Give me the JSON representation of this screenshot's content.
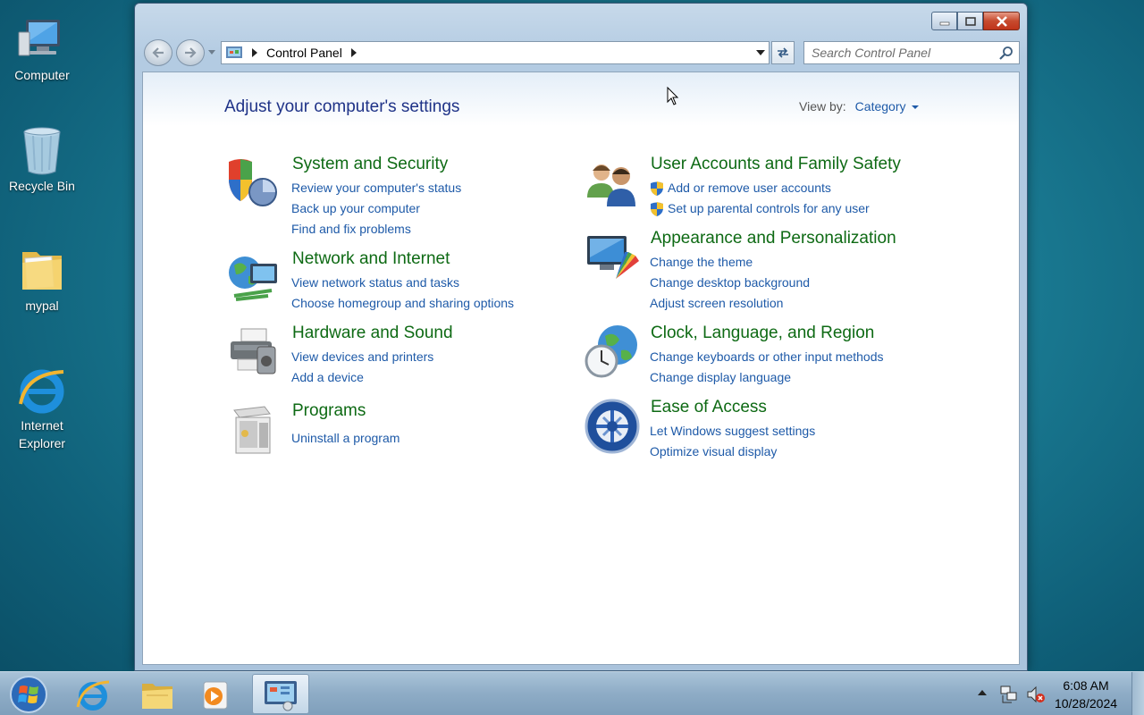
{
  "desktop": {
    "icons": [
      {
        "label": "Computer",
        "icon": "computer-icon"
      },
      {
        "label": "Recycle Bin",
        "icon": "recycle-bin-icon"
      },
      {
        "label": "mypal",
        "icon": "folder-icon"
      },
      {
        "label_line1": "Internet",
        "label_line2": "Explorer",
        "icon": "internet-explorer-icon"
      }
    ]
  },
  "window": {
    "address": {
      "segment": "Control Panel"
    },
    "search": {
      "placeholder": "Search Control Panel"
    },
    "heading": "Adjust your computer's settings",
    "view_by": {
      "label": "View by:",
      "value": "Category"
    },
    "categories": [
      {
        "title": "System and Security",
        "icon": "system-security-icon",
        "links": [
          "Review your computer's status",
          "Back up your computer",
          "Find and fix problems"
        ]
      },
      {
        "title": "Network and Internet",
        "icon": "network-internet-icon",
        "links": [
          "View network status and tasks",
          "Choose homegroup and sharing options"
        ]
      },
      {
        "title": "Hardware and Sound",
        "icon": "hardware-sound-icon",
        "links": [
          "View devices and printers",
          "Add a device"
        ]
      },
      {
        "title": "Programs",
        "icon": "programs-icon",
        "links": [
          "Uninstall a program"
        ]
      },
      {
        "title": "User Accounts and Family Safety",
        "icon": "user-accounts-icon",
        "links": [
          "Add or remove user accounts",
          "Set up parental controls for any user"
        ]
      },
      {
        "title": "Appearance and Personalization",
        "icon": "appearance-icon",
        "links": [
          "Change the theme",
          "Change desktop background",
          "Adjust screen resolution"
        ]
      },
      {
        "title": "Clock, Language, and Region",
        "icon": "clock-language-icon",
        "links": [
          "Change keyboards or other input methods",
          "Change display language"
        ]
      },
      {
        "title": "Ease of Access",
        "icon": "ease-of-access-icon",
        "links": [
          "Let Windows suggest settings",
          "Optimize visual display"
        ]
      }
    ]
  },
  "taskbar": {
    "items": [
      "internet-explorer-icon",
      "windows-explorer-icon",
      "media-player-icon",
      "control-panel-icon"
    ],
    "clock": {
      "time": "6:08 AM",
      "date": "10/28/2024"
    }
  },
  "colors": {
    "title_green": "#0e6a14",
    "link_blue": "#1e5aa8",
    "heading_blue": "#1e3287"
  }
}
